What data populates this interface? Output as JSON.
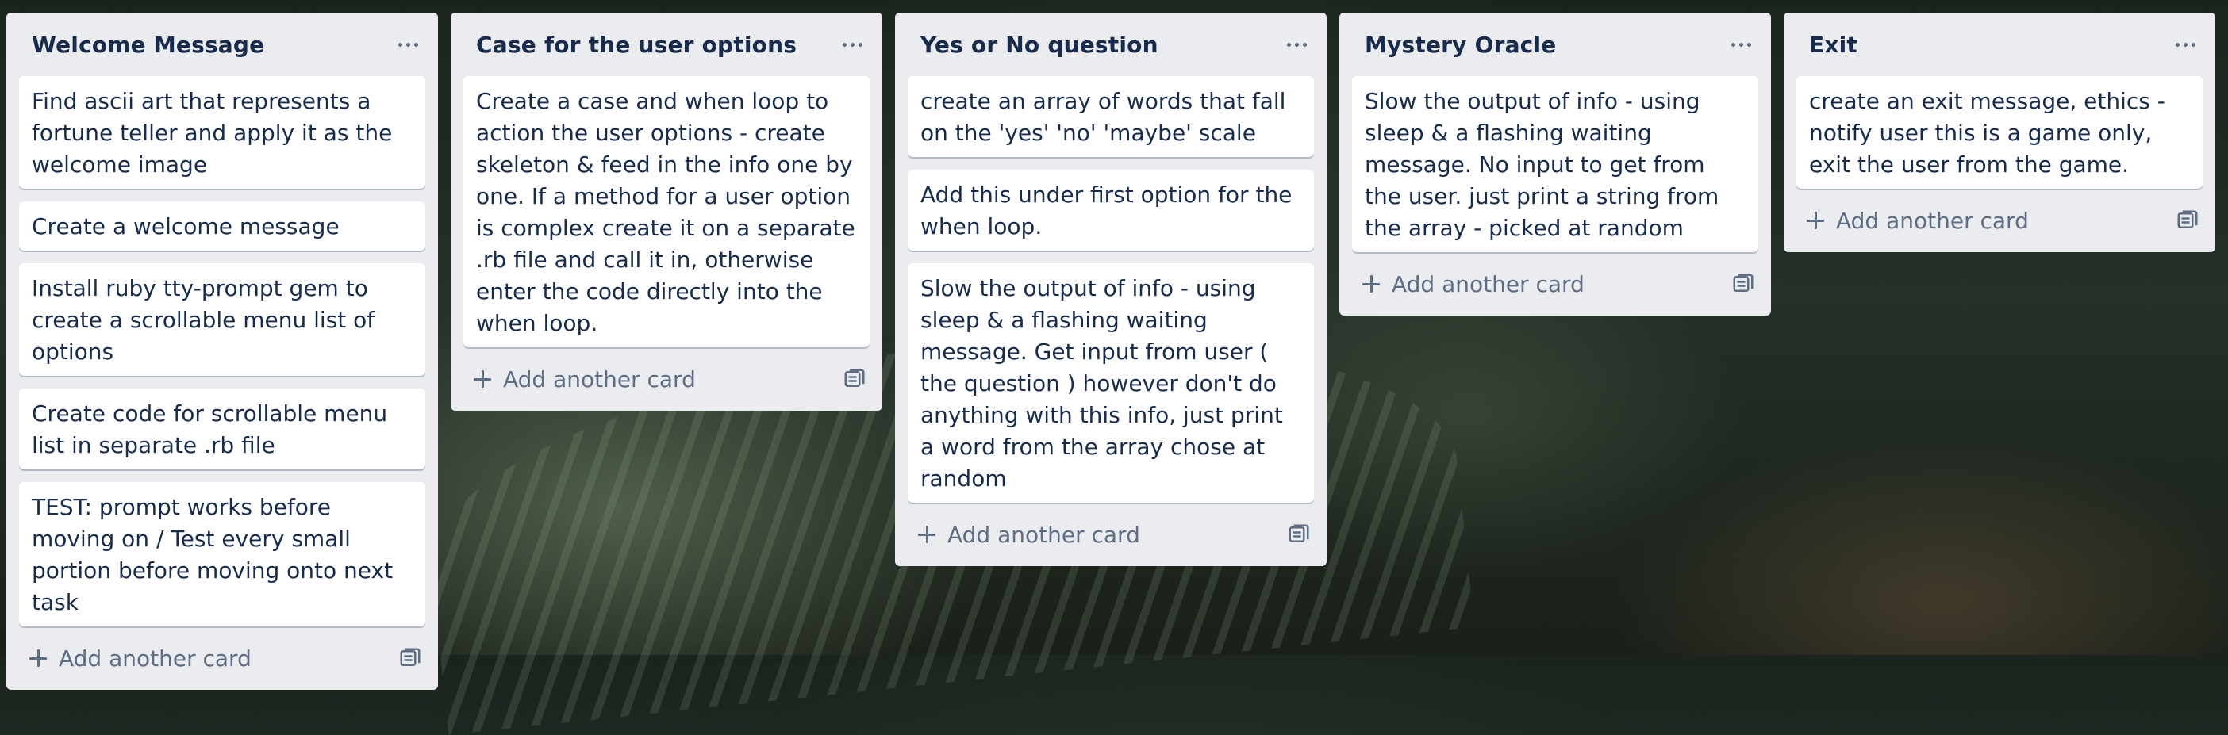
{
  "board": {
    "lists": [
      {
        "title": "Welcome Message",
        "cards": [
          "Find ascii art that represents a fortune teller and apply it as the welcome image",
          "Create a welcome message",
          "Install ruby tty-prompt gem to create a scrollable menu list of options",
          "Create code for scrollable menu list in separate .rb file",
          "TEST: prompt works before moving on / Test every small portion before moving onto next task"
        ],
        "add_label": "Add another card"
      },
      {
        "title": "Case for the user options",
        "cards": [
          "Create a case and when loop to action the user options - create skeleton & feed in the info one by one. If a method for a user option is complex create it on a separate .rb file and call it in, otherwise enter the code directly into the when loop."
        ],
        "add_label": "Add another card"
      },
      {
        "title": "Yes or No question",
        "cards": [
          "create an array of words that fall on the 'yes' 'no' 'maybe' scale",
          "Add this under first option for the when loop.",
          "Slow the output of info - using sleep & a flashing waiting message. Get input from user ( the question ) however don't do anything with this info, just print a word from the array chose at random"
        ],
        "add_label": "Add another card"
      },
      {
        "title": "Mystery Oracle",
        "cards": [
          "Slow the output of info - using sleep & a flashing waiting message. No input to get from the user. just print a string from the array - picked at random"
        ],
        "add_label": "Add another card"
      },
      {
        "title": "Exit",
        "cards": [
          "create an exit message, ethics - notify user this is a game only, exit the user from the game."
        ],
        "add_label": "Add another card"
      }
    ]
  },
  "icons": {
    "list_menu": "more-horizontal-icon",
    "add": "plus-icon",
    "template": "card-template-icon"
  },
  "colors": {
    "list_bg": "#ebecf0",
    "card_bg": "#ffffff",
    "title_text": "#172b4d",
    "muted_text": "#5e6c84"
  }
}
